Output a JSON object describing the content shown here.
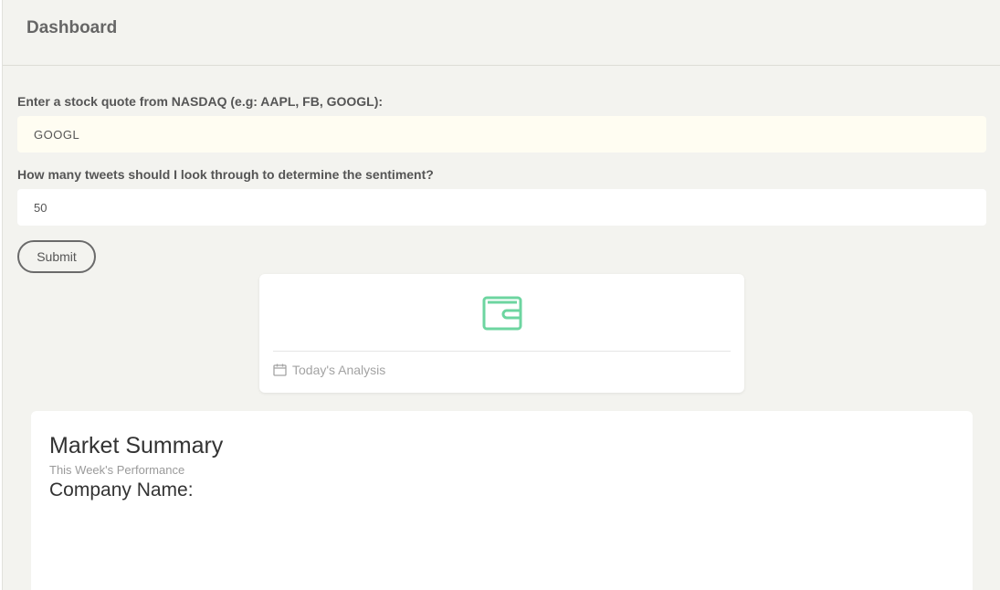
{
  "header": {
    "brand": "Dashboard"
  },
  "form": {
    "quote_label": "Enter a stock quote from NASDAQ (e.g: AAPL, FB, GOOGL):",
    "quote_value": "GOOGL",
    "tweets_label": "How many tweets should I look through to determine the sentiment?",
    "tweets_value": "50",
    "submit_label": "Submit"
  },
  "stat_card": {
    "icon": "wallet-icon",
    "footer_icon": "calendar-icon",
    "footer_text": "Today's Analysis",
    "accent_color": "#6dd5a0"
  },
  "summary": {
    "title": "Market Summary",
    "subtitle": "This Week's Performance",
    "company_label": "Company Name:"
  }
}
